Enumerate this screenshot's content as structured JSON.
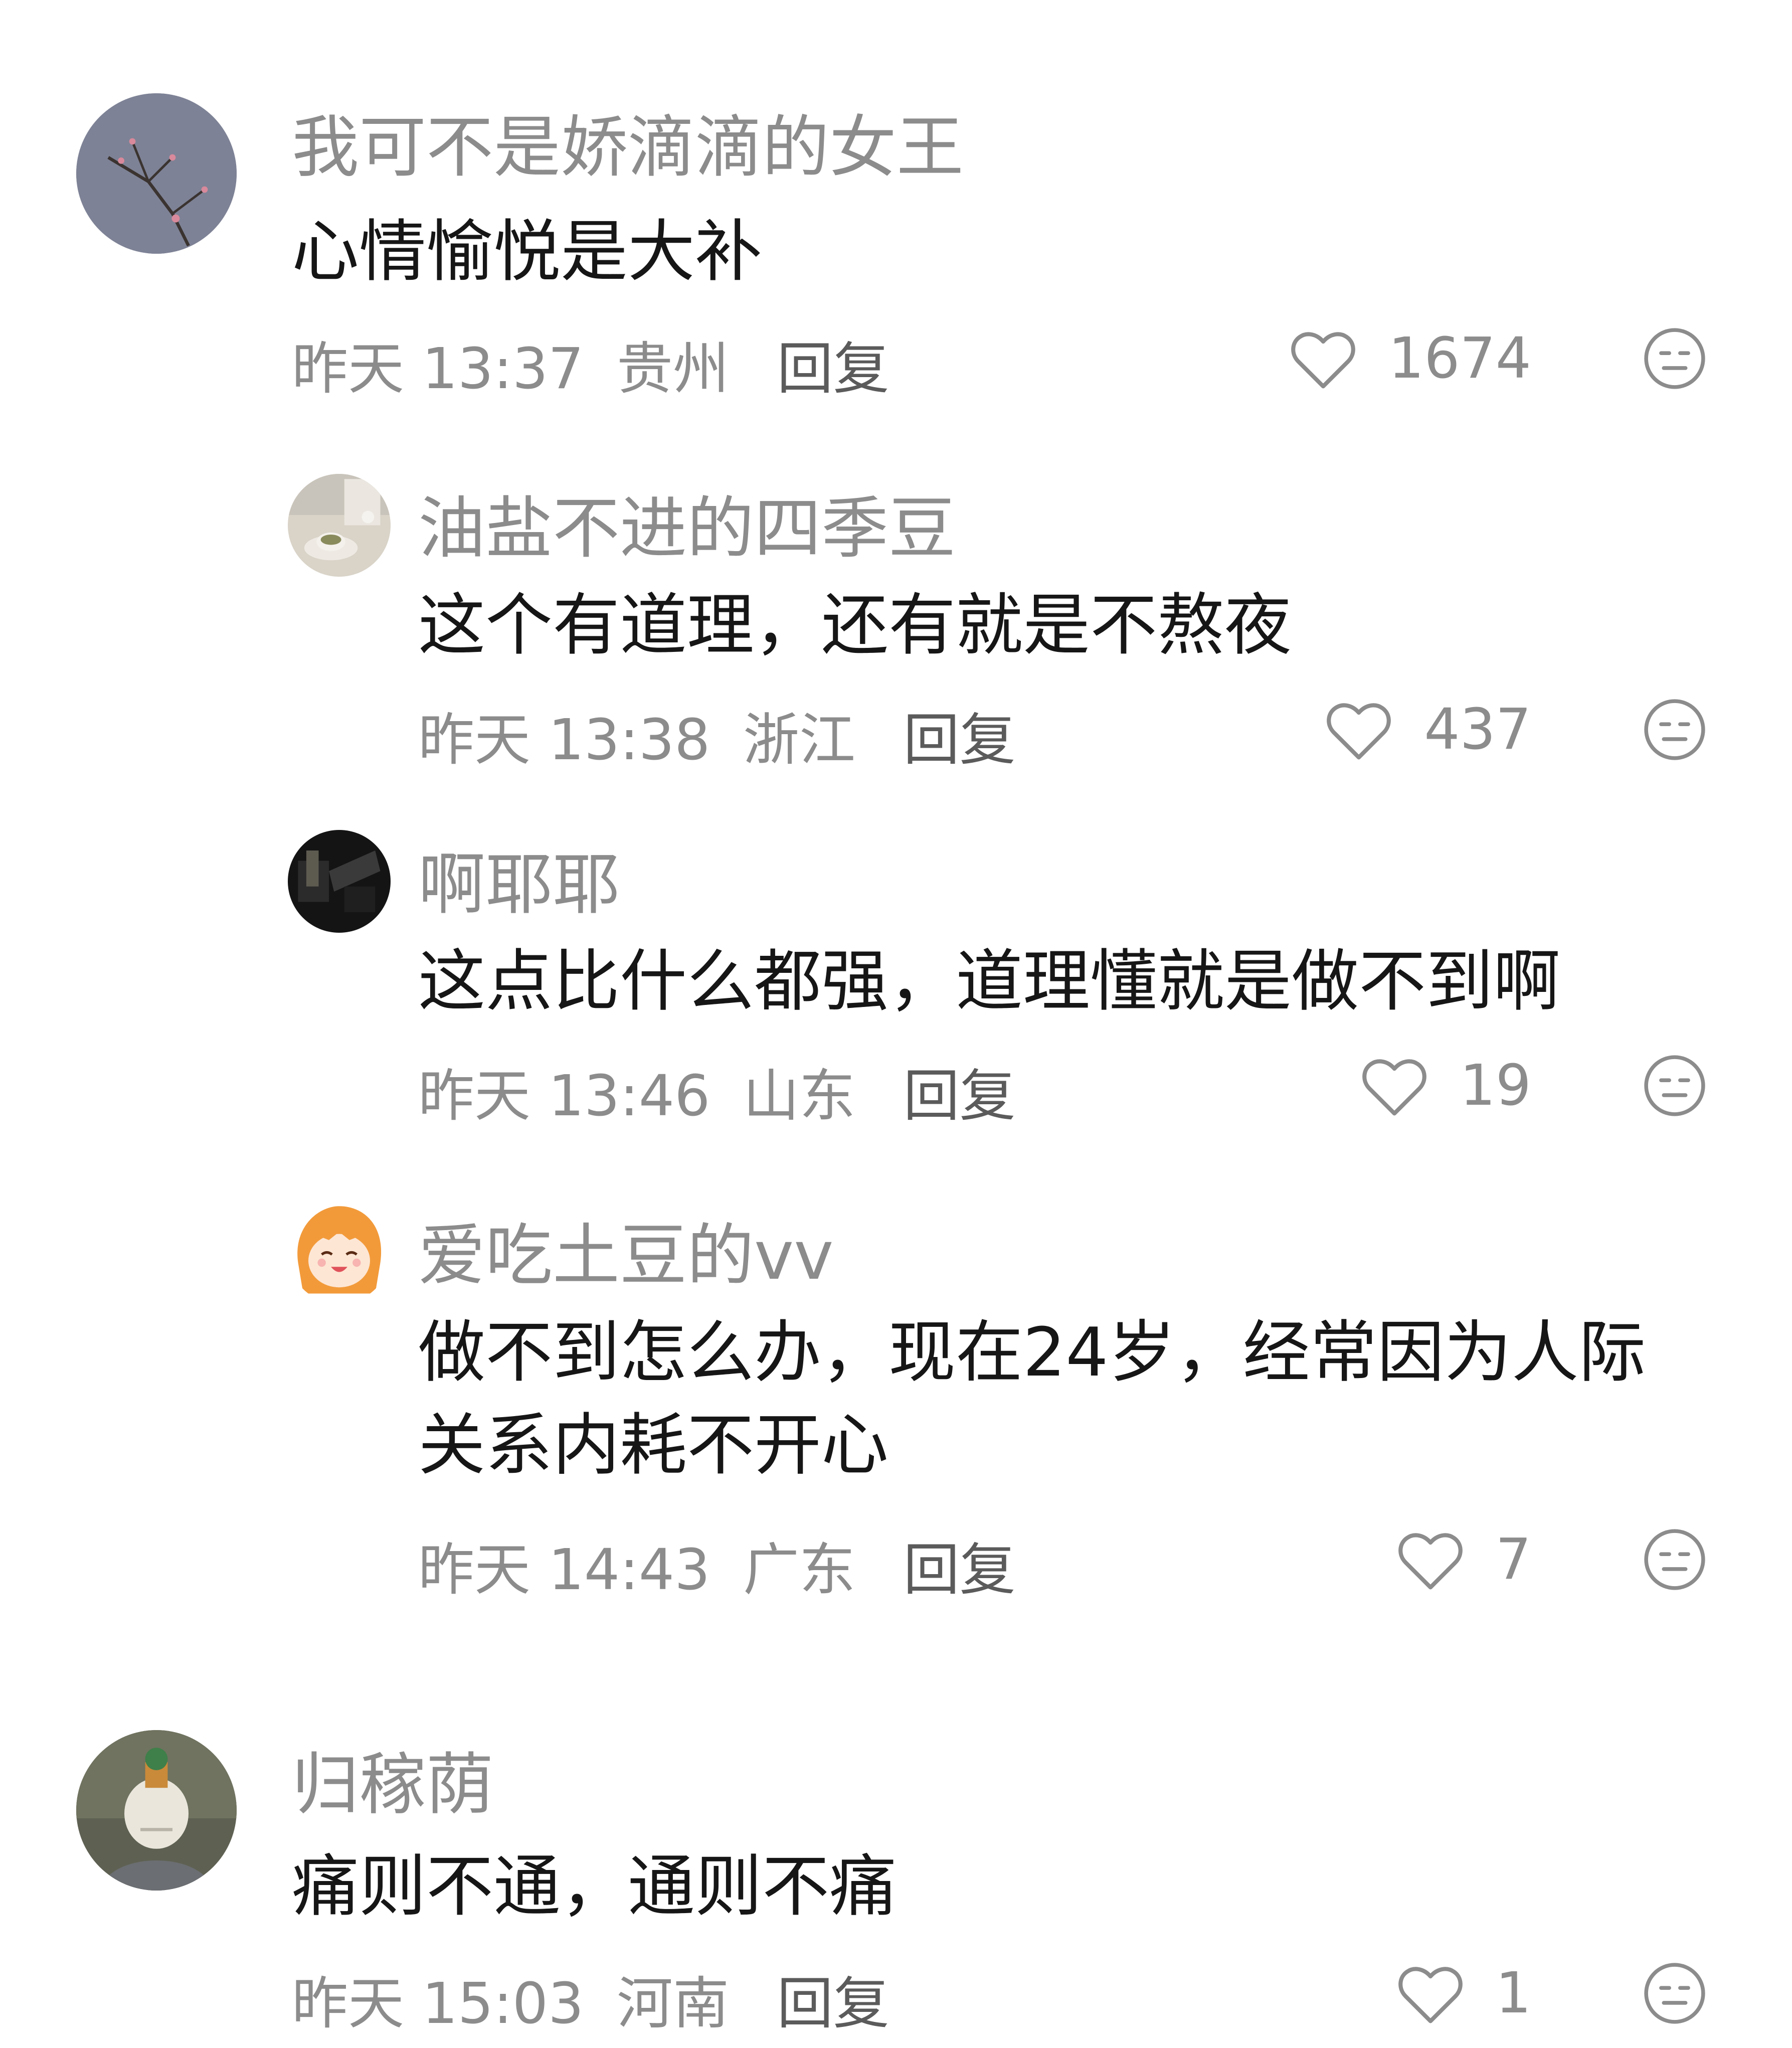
{
  "comments": [
    {
      "username": "我可不是娇滴滴的女王",
      "text": "心情愉悦是大补",
      "date": "昨天 13:37",
      "location": "贵州",
      "reply": "回复",
      "likes": "1674",
      "avatar_icon": "avatar-plum-branch"
    },
    {
      "username": "油盐不进的四季豆",
      "text": "这个有道理，还有就是不熬夜",
      "date": "昨天 13:38",
      "location": "浙江",
      "reply": "回复",
      "likes": "437",
      "avatar_icon": "avatar-tea-cup"
    },
    {
      "username": "啊耶耶",
      "text": "这点比什么都强，道理懂就是做不到啊",
      "date": "昨天 13:46",
      "location": "山东",
      "reply": "回复",
      "likes": "19",
      "avatar_icon": "avatar-dark-photo"
    },
    {
      "username": "爱吃土豆的vv",
      "text": "做不到怎么办，现在24岁，经常因为人际关系内耗不开心",
      "date": "昨天 14:43",
      "location": "广东",
      "reply": "回复",
      "likes": "7",
      "avatar_icon": "avatar-anime-girl"
    },
    {
      "username": "归稼荫",
      "text": "痛则不通，通则不痛",
      "date": "昨天 15:03",
      "location": "河南",
      "reply": "回复",
      "likes": "1",
      "avatar_icon": "avatar-person-helmet"
    }
  ],
  "icons": {
    "like": "heart-outline-icon",
    "dislike": "neutral-face-icon"
  },
  "colors": {
    "username": "#8c8c8c",
    "text": "#161616",
    "meta": "#8c8c8c",
    "reply": "#5b5b5b"
  }
}
